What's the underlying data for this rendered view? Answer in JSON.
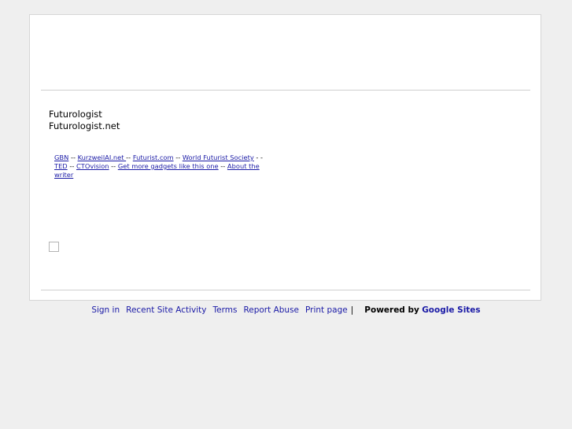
{
  "site": {
    "title": "Futurologist",
    "subtitle": "Futurologist.net"
  },
  "links": {
    "gbn": "GBN",
    "kurzweil": "KurzweilAI.net ",
    "futurist_com": "Futurist.com",
    "wfs": "World Futurist Society",
    "ted": "TED",
    "ctovision": "CTOvision",
    "gadgets": "Get more gadgets like this one",
    "about": "About the writer",
    "sep_1": " -- ",
    "sep_2": " -- ",
    "sep_3": "  -- ",
    "sep_4": " - - ",
    "sep_5": " --  ",
    "sep_6": " -- ",
    "sep_7": " -- "
  },
  "footer": {
    "sign_in": "Sign in",
    "recent_activity": "Recent Site Activity",
    "terms": "Terms",
    "report_abuse": "Report Abuse",
    "print_page": "Print page",
    "separator": "|",
    "powered_by": "Powered by",
    "google_sites": "Google Sites"
  },
  "colors": {
    "background": "#efefef",
    "page": "#ffffff",
    "link": "#1a1aa6",
    "rule": "#cfcfcf"
  }
}
